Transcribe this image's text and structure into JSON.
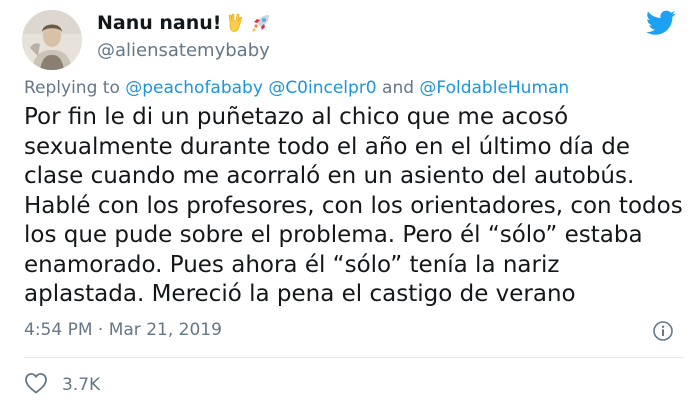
{
  "author": {
    "display_name": "Nanu nanu!",
    "handle": "@aliensatemybaby",
    "emojis": [
      "vulcan-salute-icon",
      "rocket-icon"
    ]
  },
  "reply_context": {
    "prefix": "Replying to",
    "mentions": [
      "@peachofababy",
      "@C0incelpr0",
      "@FoldableHuman"
    ],
    "conjunction": "and"
  },
  "tweet": {
    "text": "Por fin le di un puñetazo al chico que me acosó sexualmente durante todo el año en el último día de clase cuando me acorraló en un asiento del autobús. Hablé con los profesores, con los orientadores, con todos los que pude sobre el problema. Pero él “sólo” estaba enamorado. Pues ahora él “sólo” tenía la nariz aplastada. Mereció la pena el castigo de verano",
    "timestamp": "4:54 PM · Mar 21, 2019"
  },
  "engagement": {
    "likes": "3.7K"
  },
  "colors": {
    "accent": "#1da1f2",
    "link": "#1b95e0",
    "secondary_text": "#657786",
    "divider": "#e6ecf0"
  }
}
